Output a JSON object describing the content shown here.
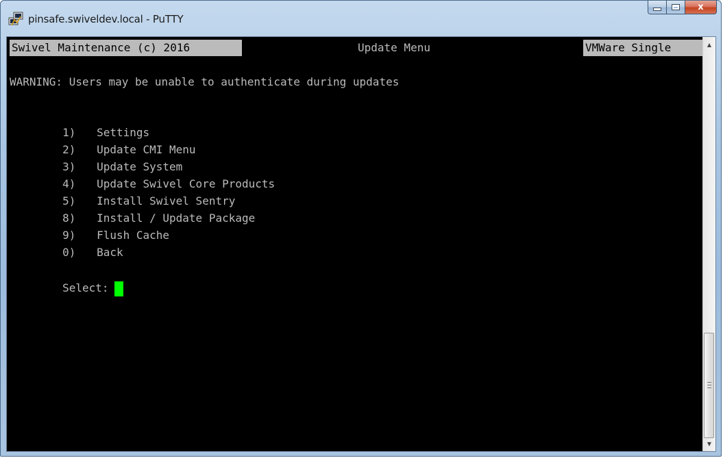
{
  "window": {
    "title": "pinsafe.swiveldev.local - PuTTY",
    "close_glyph": "x"
  },
  "terminal": {
    "status_left": "Swivel Maintenance (c) 2016",
    "status_center": "Update Menu",
    "status_right": "VMWare Single",
    "warning": "WARNING: Users may be unable to authenticate during updates",
    "menu": [
      {
        "key": "1)",
        "label": "Settings"
      },
      {
        "key": "2)",
        "label": "Update CMI Menu"
      },
      {
        "key": "3)",
        "label": "Update System"
      },
      {
        "key": "4)",
        "label": "Update Swivel Core Products"
      },
      {
        "key": "5)",
        "label": "Install Swivel Sentry"
      },
      {
        "key": "8)",
        "label": "Install / Update Package"
      },
      {
        "key": "9)",
        "label": "Flush Cache"
      },
      {
        "key": "0)",
        "label": "Back"
      }
    ],
    "prompt": "Select:",
    "cursor_color": "#00ff00"
  },
  "colors": {
    "terminal_bg": "#000000",
    "terminal_fg": "#bbbbbb",
    "status_bg": "#bbbbbb"
  },
  "icons": {
    "app": "putty-icon",
    "minimize": "minimize-icon",
    "maximize": "maximize-icon",
    "close": "close-icon"
  }
}
